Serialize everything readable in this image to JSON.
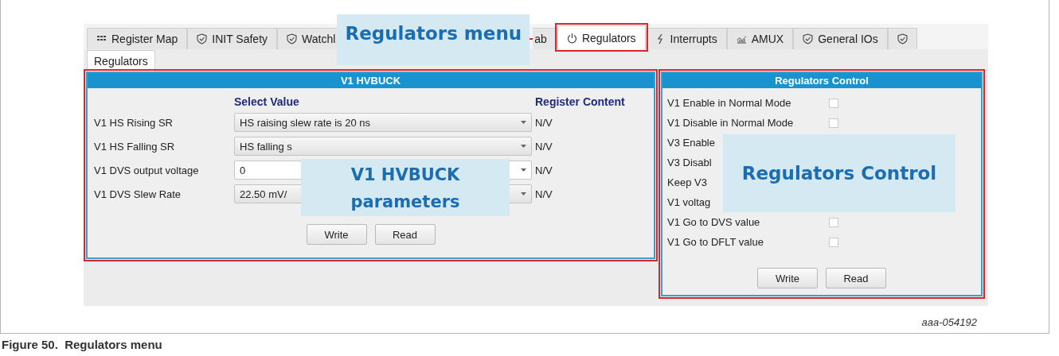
{
  "tab_bar": {
    "tabs": [
      {
        "label": "Register Map",
        "kind": "grid",
        "selected": false,
        "highlighted": false
      },
      {
        "label": "INIT Safety",
        "kind": "shield",
        "selected": false,
        "highlighted": false
      },
      {
        "label": "Watchl",
        "kind": "shield",
        "selected": false,
        "highlighted": false
      },
      {
        "label": "ab",
        "kind": "plain",
        "selected": false,
        "highlighted": false
      },
      {
        "label": "Regulators",
        "kind": "power",
        "selected": true,
        "highlighted": true
      },
      {
        "label": "Interrupts",
        "kind": "bolt",
        "selected": false,
        "highlighted": false
      },
      {
        "label": "AMUX",
        "kind": "wave",
        "selected": false,
        "highlighted": false
      },
      {
        "label": "General IOs",
        "kind": "shield",
        "selected": false,
        "highlighted": false
      },
      {
        "kind": "shield",
        "selected": false,
        "highlighted": false
      }
    ],
    "callout": "Regulators menu"
  },
  "subtabs": [
    {
      "label": "Regulators",
      "selected": true
    }
  ],
  "hvbuck_panel": {
    "title": "V1 HVBUCK",
    "highlighted": true,
    "column_headers": [
      "Select Value",
      "Register Content"
    ],
    "rows": [
      {
        "label": "V1 HS Rising SR",
        "value": "HS raising slew rate is 20 ns",
        "reading": "N/V",
        "editable": false
      },
      {
        "label": "V1 HS Falling SR",
        "value": "HS falling s",
        "reading": "N/V",
        "editable": false
      },
      {
        "label": "V1 DVS output voltage",
        "value": "0",
        "reading": "N/V",
        "editable": true
      },
      {
        "label": "V1 DVS Slew Rate",
        "value": "22.50 mV/",
        "reading": "N/V",
        "editable": false
      }
    ],
    "buttons": [
      "Write",
      "Read"
    ],
    "callout": [
      "V1 HVBUCK",
      "parameters"
    ]
  },
  "control_panel": {
    "title": "Regulators Control",
    "highlighted": true,
    "rows": [
      {
        "label": "V1 Enable in Normal Mode",
        "checked": false
      },
      {
        "label": "V1 Disable in Normal Mode",
        "checked": false
      },
      {
        "label": "V3 Enable"
      },
      {
        "label": "V3 Disabl"
      },
      {
        "label": "Keep V3"
      },
      {
        "label": "V1 voltag"
      },
      {
        "label": "V1 Go to DVS value",
        "checked": false
      },
      {
        "label": "V1 Go to DFLT value",
        "checked": false
      }
    ],
    "buttons": [
      "Write",
      "Read"
    ],
    "callout": "Regulators Control"
  },
  "figure_id": "aaa-054192",
  "caption": "Figure 50.  Regulators menu"
}
